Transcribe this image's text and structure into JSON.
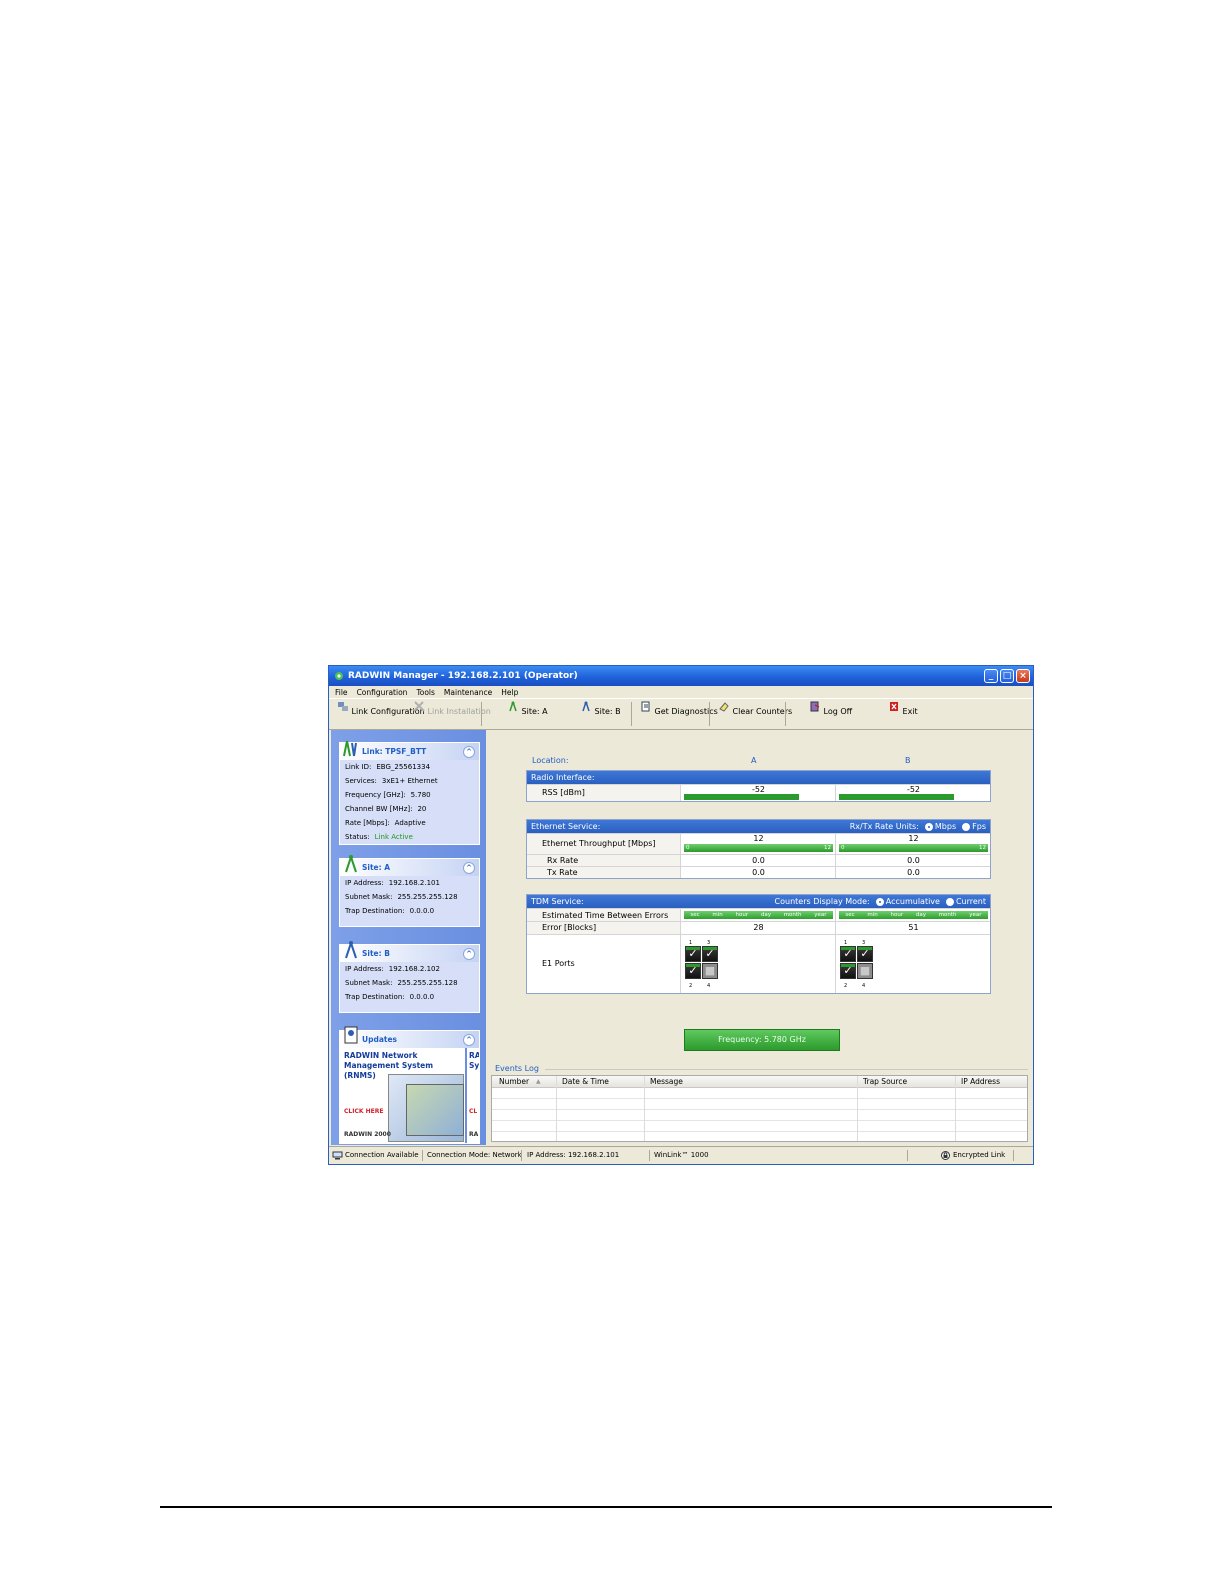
{
  "window": {
    "title": "RADWIN Manager - 192.168.2.101 (Operator)",
    "controls": {
      "minimize": "_",
      "maximize": "□",
      "close": "×"
    }
  },
  "menu": [
    "File",
    "Configuration",
    "Tools",
    "Maintenance",
    "Help"
  ],
  "toolbar": {
    "link_configuration": "Link Configuration",
    "link_installation": "Link Installation",
    "site_a": "Site: A",
    "site_b": "Site: B",
    "get_diagnostics": "Get Diagnostics",
    "clear_counters": "Clear Counters",
    "log_off": "Log Off",
    "exit": "Exit"
  },
  "link_panel": {
    "title": "Link: TPSF_BTT",
    "collapse": "^",
    "rows": [
      {
        "label": "Link ID:",
        "value": "EBG_25561334"
      },
      {
        "label": "Services:",
        "value": "3xE1+ Ethernet"
      },
      {
        "label": "Frequency [GHz]:",
        "value": "5.780"
      },
      {
        "label": "Channel BW [MHz]:",
        "value": "20"
      },
      {
        "label": "Rate [Mbps]:",
        "value": "Adaptive"
      },
      {
        "label": "Status:",
        "value": "Link Active"
      }
    ]
  },
  "site_a_panel": {
    "title": "Site: A",
    "collapse": "^",
    "rows": [
      {
        "label": "IP Address:",
        "value": "192.168.2.101"
      },
      {
        "label": "Subnet Mask:",
        "value": "255.255.255.128"
      },
      {
        "label": "Trap Destination:",
        "value": "0.0.0.0"
      }
    ]
  },
  "site_b_panel": {
    "title": "Site: B",
    "collapse": "^",
    "rows": [
      {
        "label": "IP Address:",
        "value": "192.168.2.102"
      },
      {
        "label": "Subnet Mask:",
        "value": "255.255.255.128"
      },
      {
        "label": "Trap Destination:",
        "value": "0.0.0.0"
      }
    ]
  },
  "updates_panel": {
    "title": "Updates",
    "collapse": "^",
    "headline": "RADWIN Network Management System (RNMS)",
    "headline_next": "RA Sy",
    "click_here": "CLICK HERE",
    "click_next": "CL",
    "brand": "RADWIN 2000",
    "brand_next": "RA"
  },
  "main": {
    "location_label": "Location:",
    "site_a": "A",
    "site_b": "B",
    "radio": {
      "title": "Radio Interface:",
      "rss_label": "RSS [dBm]",
      "rss_a": "-52",
      "rss_b": "-52"
    },
    "ethernet": {
      "title": "Ethernet Service:",
      "units_label": "Rx/Tx Rate Units:",
      "unit_mbps": "Mbps",
      "unit_fps": "Fps",
      "throughput_label": "Ethernet Throughput [Mbps]",
      "throughput_a": "12",
      "throughput_b": "12",
      "scale_min": "0",
      "scale_max": "12",
      "rx_label": "Rx Rate",
      "rx_a": "0.0",
      "rx_b": "0.0",
      "tx_label": "Tx Rate",
      "tx_a": "0.0",
      "tx_b": "0.0"
    },
    "tdm": {
      "title": "TDM Service:",
      "counters_label": "Counters Display Mode:",
      "mode_accumulative": "Accumulative",
      "mode_current": "Current",
      "tbe_label": "Estimated Time Between Errors",
      "tbe_scale": [
        "sec",
        "min",
        "hour",
        "day",
        "month",
        "year"
      ],
      "error_label": "Error [Blocks]",
      "error_a": "28",
      "error_b": "51",
      "e1_label": "E1 Ports",
      "port_numbers": [
        "1",
        "3",
        "2",
        "4"
      ]
    },
    "frequency_button": "Frequency: 5.780 GHz"
  },
  "events_log": {
    "title": "Events Log",
    "columns": [
      "Number",
      "Date & Time",
      "Message",
      "Trap Source",
      "IP Address"
    ]
  },
  "statusbar": {
    "connection": "Connection Available",
    "mode": "Connection Mode: Network",
    "ip": "IP Address: 192.168.2.101",
    "product": "WinLink™ 1000",
    "encryption": "Encrypted Link"
  }
}
